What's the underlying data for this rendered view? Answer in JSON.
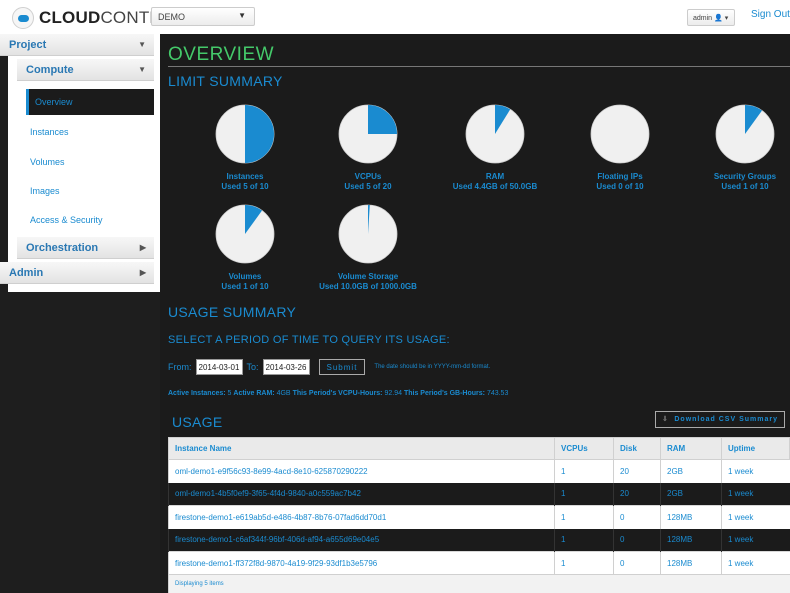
{
  "header": {
    "logo_bold": "CLOUD",
    "logo_light": "CONTROL",
    "project_select": "DEMO",
    "user": "admin",
    "sign_out": "Sign Out"
  },
  "sidebar": {
    "project": "Project",
    "compute": "Compute",
    "items": [
      "Overview",
      "Instances",
      "Volumes",
      "Images",
      "Access & Security"
    ],
    "orchestration": "Orchestration",
    "admin": "Admin"
  },
  "main": {
    "title": "OVERVIEW",
    "limit_summary": "LIMIT SUMMARY",
    "usage_summary": "USAGE SUMMARY",
    "select_period": "SELECT A PERIOD OF TIME TO QUERY ITS USAGE:",
    "from_label": "From:",
    "from_value": "2014-03-01",
    "to_label": "To:",
    "to_value": "2014-03-26",
    "submit": "Submit",
    "date_hint": "The date should be in YYYY-mm-dd format.",
    "stats": {
      "instances_label": "Active Instances:",
      "instances_value": "5",
      "ram_label": "Active RAM:",
      "ram_value": "4GB",
      "vcpu_label": "This Period's VCPU-Hours:",
      "vcpu_value": "92.94",
      "gb_label": "This Period's GB-Hours:",
      "gb_value": "743.53"
    },
    "usage_title": "USAGE",
    "csv_button": "Download CSV Summary"
  },
  "limits": [
    {
      "name": "Instances",
      "used": "Used 5 of 10",
      "fraction": 0.5
    },
    {
      "name": "VCPUs",
      "used": "Used 5 of 20",
      "fraction": 0.25
    },
    {
      "name": "RAM",
      "used": "Used 4.4GB of 50.0GB",
      "fraction": 0.088
    },
    {
      "name": "Floating IPs",
      "used": "Used 0 of 10",
      "fraction": 0
    },
    {
      "name": "Security Groups",
      "used": "Used 1 of 10",
      "fraction": 0.1
    },
    {
      "name": "Volumes",
      "used": "Used 1 of 10",
      "fraction": 0.1
    },
    {
      "name": "Volume Storage",
      "used": "Used 10.0GB of 1000.0GB",
      "fraction": 0.01
    }
  ],
  "colors": {
    "accent": "#1a8bd0",
    "title_green": "#44c96a",
    "pie_empty": "#f0f0f0"
  },
  "table": {
    "columns": [
      "Instance Name",
      "VCPUs",
      "Disk",
      "RAM",
      "Uptime"
    ],
    "rows": [
      [
        "oml-demo1-e9f56c93-8e99-4acd-8e10-625870290222",
        "1",
        "20",
        "2GB",
        "1 week"
      ],
      [
        "oml-demo1-4b5f0ef9-3f65-4f4d-9840-a0c559ac7b42",
        "1",
        "20",
        "2GB",
        "1 week"
      ],
      [
        "firestone-demo1-e619ab5d-e486-4b87-8b76-07fad6dd70d1",
        "1",
        "0",
        "128MB",
        "1 week"
      ],
      [
        "firestone-demo1-c6af344f-96bf-406d-af94-a655d69e04e5",
        "1",
        "0",
        "128MB",
        "1 week"
      ],
      [
        "firestone-demo1-ff372f8d-9870-4a19-9f29-93df1b3e5796",
        "1",
        "0",
        "128MB",
        "1 week"
      ]
    ],
    "footer": "Displaying 5 items"
  }
}
